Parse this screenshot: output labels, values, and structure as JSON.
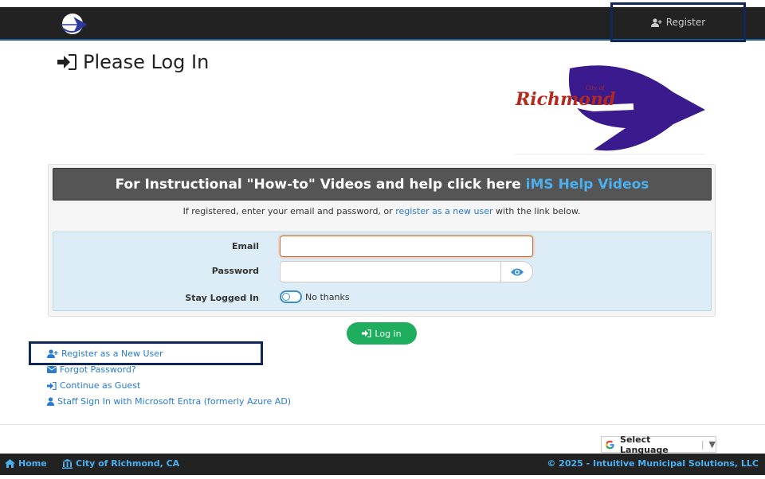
{
  "header": {
    "register_label": "Register"
  },
  "page": {
    "title": "Please Log In"
  },
  "logo": {
    "city_of": "City of",
    "name": "Richmond"
  },
  "banner": {
    "text": "For Instructional \"How-to\" Videos and help click here",
    "link": "iMS Help Videos"
  },
  "instructions": {
    "before": "If registered, enter your email and password, or",
    "link": "register as a new user",
    "after": "with the link below."
  },
  "form": {
    "email_label": "Email",
    "email_value": "",
    "password_label": "Password",
    "password_value": "",
    "stay_label": "Stay Logged In",
    "stay_option": "No thanks"
  },
  "login_button": "Log in",
  "links": {
    "register": "Register as a New User",
    "forgot": "Forgot Password?",
    "guest": "Continue as Guest",
    "staff": "Staff Sign In with Microsoft Entra (formerly Azure AD)"
  },
  "translate": {
    "label": "Select Language"
  },
  "footer": {
    "home": "Home",
    "city": "City of Richmond, CA",
    "copyright": "© 2025 - Intuitive Municipal Solutions, LLC"
  },
  "colors": {
    "accent": "#2a7bd0",
    "success": "#1fae5e",
    "brand_purple": "#3a1a8c",
    "brand_red": "#b22a1e"
  }
}
